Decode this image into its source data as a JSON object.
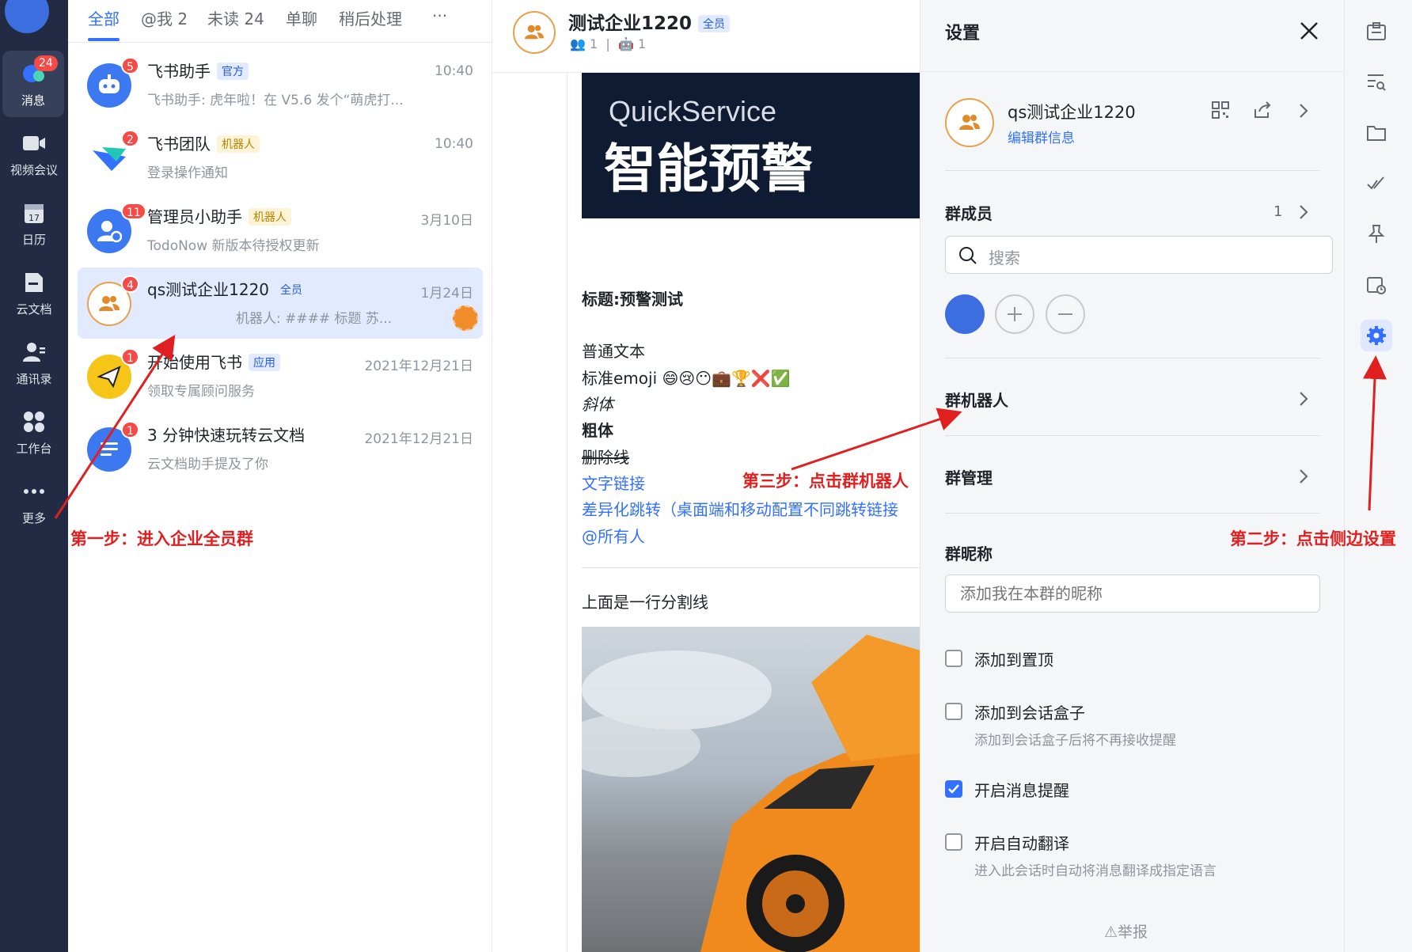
{
  "nav": {
    "items": [
      {
        "label": "消息",
        "badge": "24"
      },
      {
        "label": "视频会议"
      },
      {
        "label": "日历",
        "day": "17"
      },
      {
        "label": "云文档"
      },
      {
        "label": "通讯录"
      },
      {
        "label": "工作台"
      },
      {
        "label": "更多"
      }
    ]
  },
  "chatlist": {
    "tabs": [
      "全部",
      "@我 2",
      "未读 24",
      "单聊",
      "稍后处理",
      "···"
    ],
    "chats": [
      {
        "name": "飞书助手",
        "tag": "官方",
        "time": "10:40",
        "preview": "飞书助手: 虎年啦！在 V5.6 发个“萌虎打...",
        "badge": "5"
      },
      {
        "name": "飞书团队",
        "tag": "机器人",
        "time": "10:40",
        "preview": "登录操作通知",
        "badge": "2"
      },
      {
        "name": "管理员小助手",
        "tag": "机器人",
        "time": "3月10日",
        "preview": "TodoNow 新版本待授权更新",
        "badge": "11"
      },
      {
        "name": "qs测试企业1220",
        "tag": "全员",
        "time": "1月24日",
        "preview": "机器人: #### 标题 苏...",
        "badge": "4"
      },
      {
        "name": "开始使用飞书",
        "tag": "应用",
        "time": "2021年12月21日",
        "preview": "领取专属顾问服务",
        "badge": "1"
      },
      {
        "name": "3 分钟快速玩转云文档",
        "tag": "",
        "time": "2021年12月21日",
        "preview": "云文档助手提及了你",
        "badge": "1"
      }
    ]
  },
  "chat": {
    "title": "测试企业1220",
    "title_tag": "全员",
    "members": "1",
    "bots": "1",
    "banner_brand": "QuickService",
    "banner_text": "智能预警",
    "lines": {
      "title": "标题:预警测试",
      "plain": "普通文本",
      "emoji": "标准emoji 😄😢😶💼🏆❌✅",
      "italic": "斜体",
      "bold": "粗体",
      "strike": "删除线",
      "link": "文字链接",
      "diff": "差异化跳转（桌面端和移动配置不同跳转链接",
      "at": "@所有人",
      "divider_note": "上面是一行分割线"
    }
  },
  "settings": {
    "title": "设置",
    "group_name": "qs测试企业1220",
    "edit_info": "编辑群信息",
    "members_title": "群成员",
    "members_count": "1",
    "search_placeholder": "搜索",
    "bots_title": "群机器人",
    "manage_title": "群管理",
    "nickname_title": "群昵称",
    "nickname_placeholder": "添加我在本群的昵称",
    "options": [
      {
        "label": "添加到置顶",
        "checked": false
      },
      {
        "label": "添加到会话盒子",
        "sub": "添加到会话盒子后将不再接收提醒",
        "checked": false
      },
      {
        "label": "开启消息提醒",
        "checked": true
      },
      {
        "label": "开启自动翻译",
        "sub": "进入此会话时自动将消息翻译成指定语言",
        "checked": false
      }
    ],
    "report": "举报"
  },
  "annotations": {
    "step1": "第一步：进入企业全员群",
    "step2": "第二步：点击侧边设置",
    "step3": "第三步：点击群机器人"
  },
  "colors": {
    "accent": "#3370ff",
    "nav_bg": "#222b43",
    "annotation": "#e02020"
  }
}
